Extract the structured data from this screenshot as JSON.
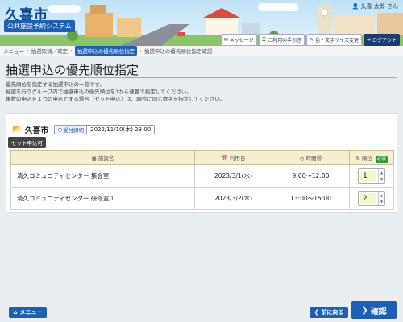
{
  "header": {
    "city_name": "久喜市",
    "system_name": "公共施設予約システム",
    "user_label": "久喜 太郎 さん",
    "buttons": {
      "message": "メッセージ",
      "usage": "ご利用の手引き",
      "display": "色・文字サイズ変更",
      "logout": "ログアウト"
    }
  },
  "breadcrumb": {
    "items": [
      "メニュー",
      "抽選取消／確定",
      "抽選申込の優先順位指定",
      "抽選申込の優先順位指定確認"
    ]
  },
  "page": {
    "title": "抽選申込の優先順位指定",
    "desc_lines": [
      "優先順位を指定する抽選申込の一覧です。",
      "抽選を行うグループ内で抽選申込の優先順位を1から連番で指定してください。",
      "複数の申込を１つの申込とする場合（セット申込）は、順位に同じ数字を指定してください。"
    ]
  },
  "facility": {
    "name": "久喜市",
    "deadline_label": "受付締切",
    "deadline_value": "2022/11/10(木) 23:00",
    "set_badge": "セット申込可"
  },
  "table": {
    "headers": {
      "facility": "施設名",
      "date": "利用日",
      "time": "時間帯",
      "rank": "順位",
      "required": "必須"
    },
    "rows": [
      {
        "facility": "清久コミュニティセンター 集会室",
        "date": "2023/3/1(水)",
        "time": "9:00～12:00",
        "rank": "1"
      },
      {
        "facility": "清久コミュニティセンター 研修室１",
        "date": "2023/3/2(木)",
        "time": "13:00～15:00",
        "rank": "2"
      }
    ]
  },
  "footer": {
    "menu": "メニュー",
    "back": "前に戻る",
    "confirm": "確認"
  },
  "colors": {
    "primary": "#1d5fb5",
    "header_bg": "#cfe7f7",
    "table_header_bg": "#f6eed0",
    "required_badge": "#2e9a3d",
    "rank_input_bg": "#f5f7c8"
  }
}
